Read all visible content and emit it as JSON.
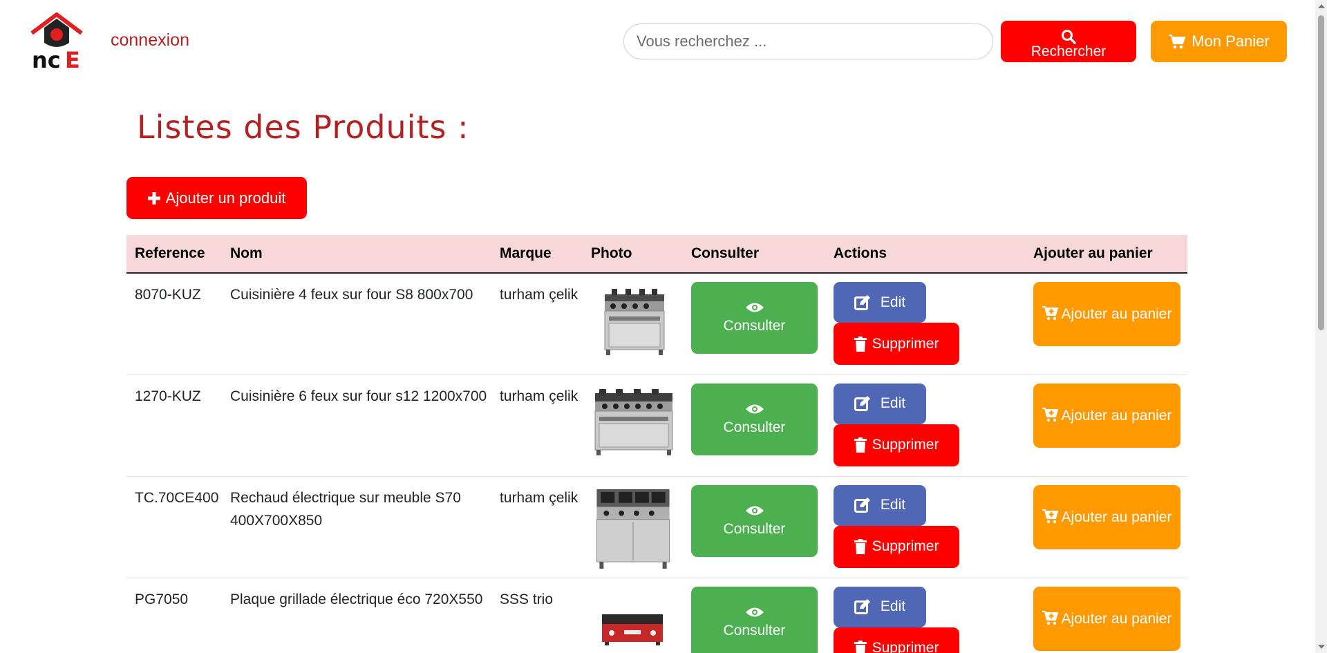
{
  "header": {
    "login_link": "connexion",
    "search_placeholder": "Vous recherchez ...",
    "search_button": "Rechercher",
    "cart_button": "Mon Panier"
  },
  "page": {
    "title": "Listes des Produits :",
    "add_button": "Ajouter un produit"
  },
  "table": {
    "headers": [
      "Reference",
      "Nom",
      "Marque",
      "Photo",
      "Consulter",
      "Actions",
      "Ajouter au panier"
    ],
    "rows": [
      {
        "reference": "8070-KUZ",
        "nom": "Cuisinière 4 feux sur four S8 800x700",
        "marque": "turham çelik",
        "photo_icon": "stove-4-burner-oven-image"
      },
      {
        "reference": "1270-KUZ",
        "nom": "Cuisinière 6 feux sur four s12 1200x700",
        "marque": "turham çelik",
        "photo_icon": "stove-6-burner-oven-image"
      },
      {
        "reference": "TC.70CE400",
        "nom": "Rechaud électrique sur meuble S70 400X700X850",
        "marque": "turham çelik",
        "photo_icon": "electric-range-cabinet-image"
      },
      {
        "reference": "PG7050",
        "nom": "Plaque grillade électrique éco 720X550",
        "marque": "SSS trio",
        "photo_icon": "electric-griddle-image"
      }
    ],
    "consult_label": "Consulter",
    "edit_label": "Edit",
    "delete_label": "Supprimer",
    "add_to_cart_label": "Ajouter au panier"
  },
  "colors": {
    "brand_red": "#ff0000",
    "title_red": "#b22222",
    "orange": "#ff9900",
    "green": "#4caf50",
    "blue": "#4f67b5",
    "header_row": "#f8d7da"
  }
}
